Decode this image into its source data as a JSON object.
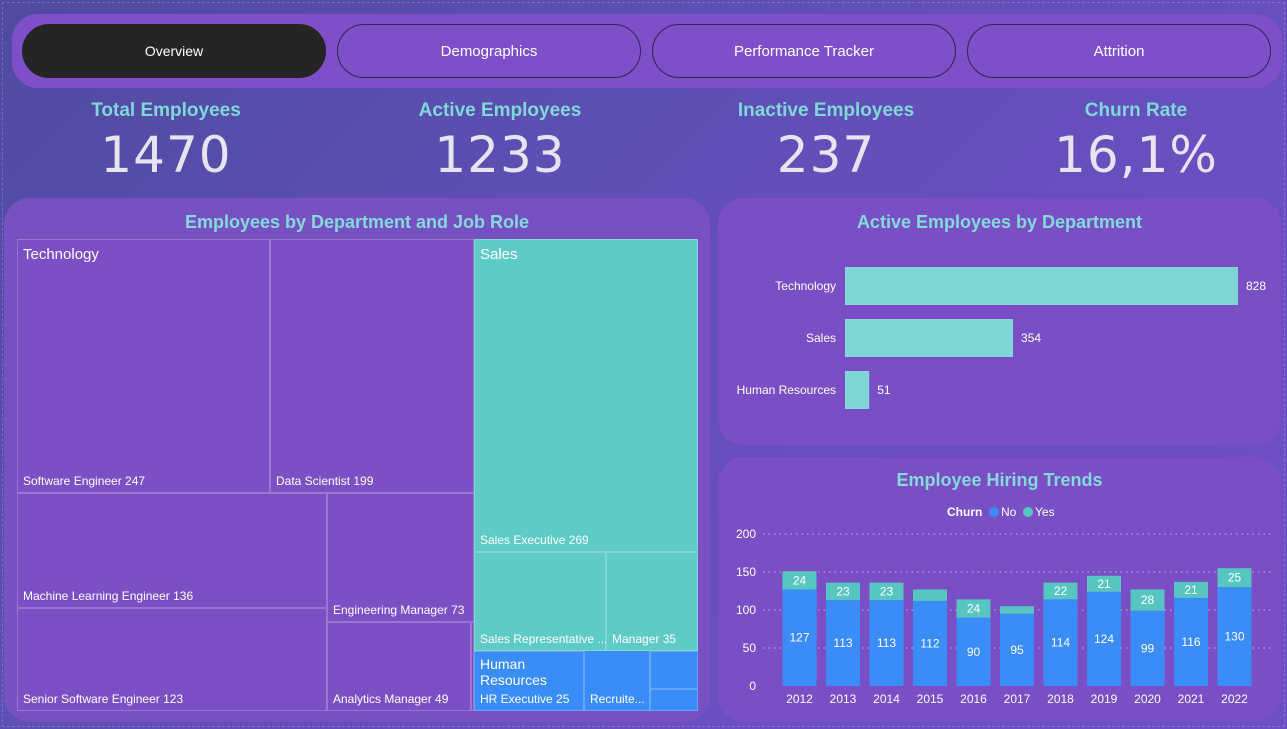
{
  "nav": {
    "tabs": [
      {
        "label": "Overview",
        "active": true
      },
      {
        "label": "Demographics",
        "active": false
      },
      {
        "label": "Performance Tracker",
        "active": false
      },
      {
        "label": "Attrition",
        "active": false
      }
    ]
  },
  "kpis": [
    {
      "title": "Total Employees",
      "value": "1470"
    },
    {
      "title": "Active Employees",
      "value": "1233"
    },
    {
      "title": "Inactive Employees",
      "value": "237"
    },
    {
      "title": "Churn Rate",
      "value": "16,1%"
    }
  ],
  "colors": {
    "technology": "#7c50c4",
    "sales": "#5ecbc6",
    "hr": "#3a8cf7",
    "bar_teal": "#80d6d4",
    "churn_no": "#3a8cf7",
    "churn_yes": "#58c6c0",
    "title_teal": "#82dbd8"
  },
  "treemap": {
    "title": "Employees by Department and Job Role",
    "departments": [
      {
        "name": "Technology",
        "roles": [
          {
            "label": "Software Engineer 247"
          },
          {
            "label": "Data Scientist 199"
          },
          {
            "label": "Machine Learning Engineer 136"
          },
          {
            "label": "Engineering Manager 73"
          },
          {
            "label": "Senior Software Engineer 123"
          },
          {
            "label": "Analytics Manager 49"
          }
        ]
      },
      {
        "name": "Sales",
        "roles": [
          {
            "label": "Sales Executive 269"
          },
          {
            "label": "Sales Representative ..."
          },
          {
            "label": "Manager 35"
          }
        ]
      },
      {
        "name": "Human Resources",
        "roles": [
          {
            "label": "HR Executive 25"
          },
          {
            "label": "Recruite..."
          }
        ]
      }
    ]
  },
  "chart_data": [
    {
      "type": "bar",
      "orientation": "horizontal",
      "title": "Active Employees by Department",
      "categories": [
        "Technology",
        "Sales",
        "Human Resources"
      ],
      "values": [
        828,
        354,
        51
      ]
    },
    {
      "type": "bar",
      "stacked": true,
      "title": "Employee Hiring Trends",
      "legend_title": "Churn",
      "categories": [
        "2012",
        "2013",
        "2014",
        "2015",
        "2016",
        "2017",
        "2018",
        "2019",
        "2020",
        "2021",
        "2022"
      ],
      "series": [
        {
          "name": "No",
          "values": [
            127,
            113,
            113,
            112,
            90,
            95,
            114,
            124,
            99,
            116,
            130
          ]
        },
        {
          "name": "Yes",
          "values": [
            24,
            23,
            23,
            15,
            24,
            10,
            22,
            21,
            28,
            21,
            25
          ],
          "labels": [
            "24",
            "23",
            "23",
            "",
            "24",
            "",
            "22",
            "21",
            "28",
            "21",
            "25"
          ]
        }
      ],
      "ylim": [
        0,
        200
      ],
      "yticks": [
        "0",
        "50",
        "100",
        "150",
        "200"
      ],
      "legend_position": "top"
    }
  ]
}
